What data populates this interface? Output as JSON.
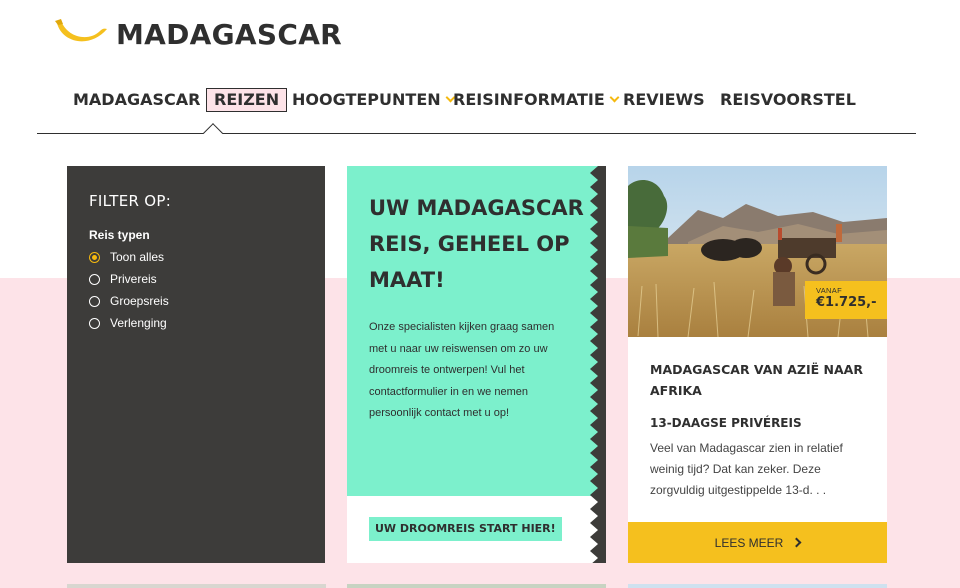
{
  "header": {
    "logo_text": "MADAGASCAR"
  },
  "nav": {
    "items": [
      {
        "label": "MADAGASCAR",
        "active": false,
        "dropdown": false
      },
      {
        "label": "REIZEN",
        "active": true,
        "dropdown": false
      },
      {
        "label": "HOOGTEPUNTEN",
        "active": false,
        "dropdown": true
      },
      {
        "label": "REISINFORMATIE",
        "active": false,
        "dropdown": true
      },
      {
        "label": "REVIEWS",
        "active": false,
        "dropdown": false
      },
      {
        "label": "REISVOORSTEL",
        "active": false,
        "dropdown": false
      }
    ]
  },
  "filter": {
    "title": "FILTER OP:",
    "group_label": "Reis typen",
    "options": [
      {
        "label": "Toon alles",
        "checked": true
      },
      {
        "label": "Privereis",
        "checked": false
      },
      {
        "label": "Groepsreis",
        "checked": false
      },
      {
        "label": "Verlenging",
        "checked": false
      }
    ]
  },
  "promo": {
    "heading": "UW MADAGASCAR REIS, GEHEEL OP MAAT!",
    "body": "Onze specialisten kijken graag samen met u naar uw reiswensen om zo uw droomreis te ontwerpen! Vul het contactformulier in en we nemen persoonlijk contact met u op!",
    "button": "UW DROOMREIS START HIER!"
  },
  "trip": {
    "price_prefix": "VANAF",
    "price": "€1.725,-",
    "title": "MADAGASCAR VAN AZIË NAAR AFRIKA",
    "type": "13-DAAGSE PRIVÉREIS",
    "description": "Veel van Madagascar zien in relatief weinig tijd? Dat kan zeker. Deze zorgvuldig uitgestippelde 13-d. . .",
    "button": "LEES MEER"
  },
  "colors": {
    "accent_yellow": "#f5c01e",
    "mint": "#7cf0cc",
    "dark_panel": "#3d3c3a",
    "pink_band": "#fde3e8",
    "text_dark": "#2f2f2f"
  },
  "icons": {
    "logo": "banana-icon",
    "dropdown": "chevron-down-icon",
    "button_arrow": "chevron-right-icon"
  }
}
